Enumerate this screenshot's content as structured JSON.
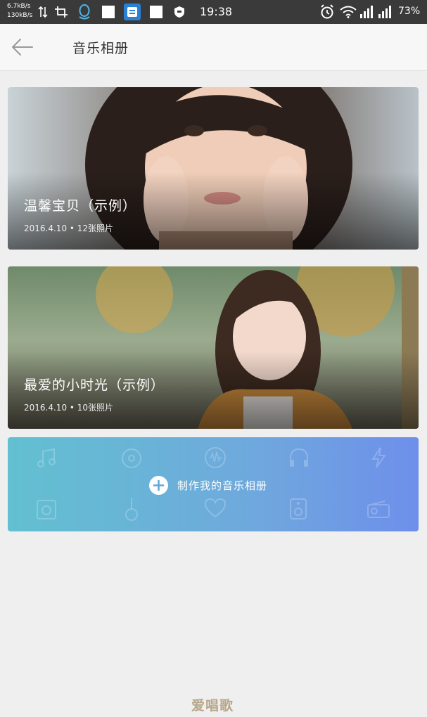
{
  "status_bar": {
    "net_speed_up": "6.7kB/s",
    "net_speed_down": "130kB/s",
    "time": "19:38",
    "battery": "73%",
    "icons": [
      "data-arrows-icon",
      "crop-icon",
      "qq-icon",
      "notification-square-icon",
      "app-icon",
      "notification-square-icon",
      "shield-icon",
      "alarm-icon",
      "wifi-icon",
      "signal-icon",
      "signal-icon"
    ]
  },
  "header": {
    "back_icon": "back-arrow-icon",
    "title": "音乐相册"
  },
  "albums": [
    {
      "title": "温馨宝贝（示例）",
      "meta": "2016.4.10 • 12张照片"
    },
    {
      "title": "最爱的小时光（示例）",
      "meta": "2016.4.10 • 10张照片"
    }
  ],
  "create": {
    "label": "制作我的音乐相册",
    "icon": "plus-circle-icon"
  },
  "watermark": "爱唱歌",
  "colors": {
    "status_bar": "#3a3a3a",
    "header_bg": "#f7f7f7",
    "page_bg": "#efefef",
    "create_gradient_start": "#62c0d1",
    "create_gradient_end": "#6e8feb"
  }
}
